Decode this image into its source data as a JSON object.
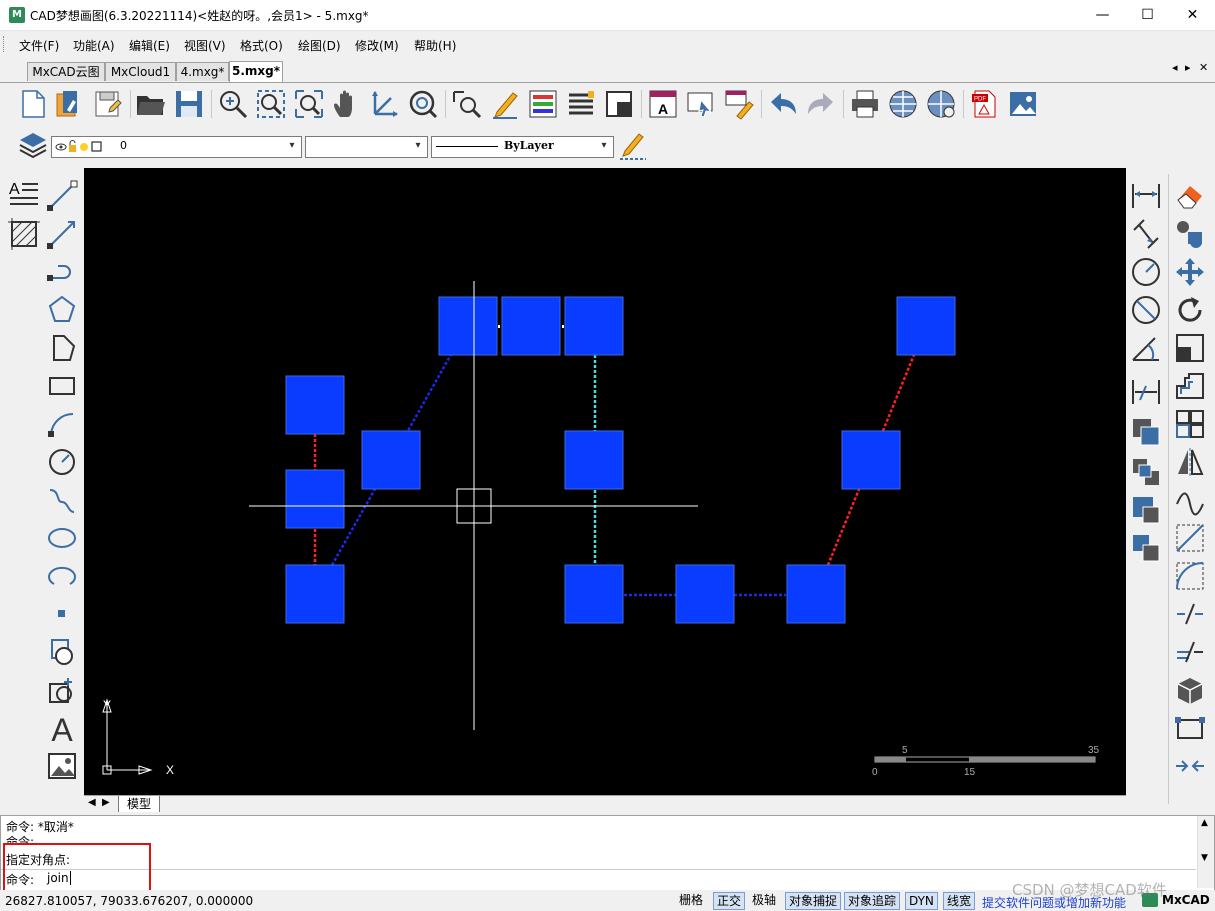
{
  "window": {
    "title": "CAD梦想画图(6.3.20221114)<姓赵的呀。,会员1> - 5.mxg*",
    "app_icon": "M",
    "minimize": "—",
    "maximize": "☐",
    "close": "✕"
  },
  "menu": [
    "文件(F)",
    "功能(A)",
    "编辑(E)",
    "视图(V)",
    "格式(O)",
    "绘图(D)",
    "修改(M)",
    "帮助(H)"
  ],
  "tabs": [
    {
      "label": "MxCAD云图",
      "active": false
    },
    {
      "label": "MxCloud1",
      "active": false
    },
    {
      "label": "4.mxg*",
      "active": false
    },
    {
      "label": "5.mxg*",
      "active": true
    }
  ],
  "tab_nav": {
    "prev": "◂",
    "next": "▸",
    "close": "✕"
  },
  "layer_combo": {
    "value": "0"
  },
  "color_combo": {
    "value": ""
  },
  "linetype_combo": {
    "value": "ByLayer"
  },
  "ucs": {
    "y_label": "Y",
    "x_label": "X"
  },
  "scale_bar": {
    "top_labels": [
      "5",
      "35"
    ],
    "bottom_labels": [
      "0",
      "15"
    ]
  },
  "model_tab": {
    "label": "模型"
  },
  "command": {
    "lines": [
      "命令:  *取消*",
      "命令:",
      " 指定对角点:"
    ],
    "prompt": "命令:",
    "input": "join"
  },
  "status": {
    "coords": "26827.810057,  79033.676207,  0.000000",
    "buttons": [
      {
        "label": "栅格",
        "on": false
      },
      {
        "label": "正交",
        "on": true
      },
      {
        "label": "极轴",
        "on": false
      },
      {
        "label": "对象捕捉",
        "on": true
      },
      {
        "label": "对象追踪",
        "on": true
      },
      {
        "label": "DYN",
        "on": true
      },
      {
        "label": "线宽",
        "on": true
      }
    ],
    "feedback_link": "提交软件问题或增加新功能",
    "brand": "MxCAD"
  },
  "watermark": "CSDN @梦想CAD软件",
  "colors": {
    "block_fill": "#0a3cff",
    "red_line": "#ff2020",
    "blue_line": "#1a2ae0",
    "cyan_line": "#40e0e0",
    "highlight_box": "#e01010"
  }
}
